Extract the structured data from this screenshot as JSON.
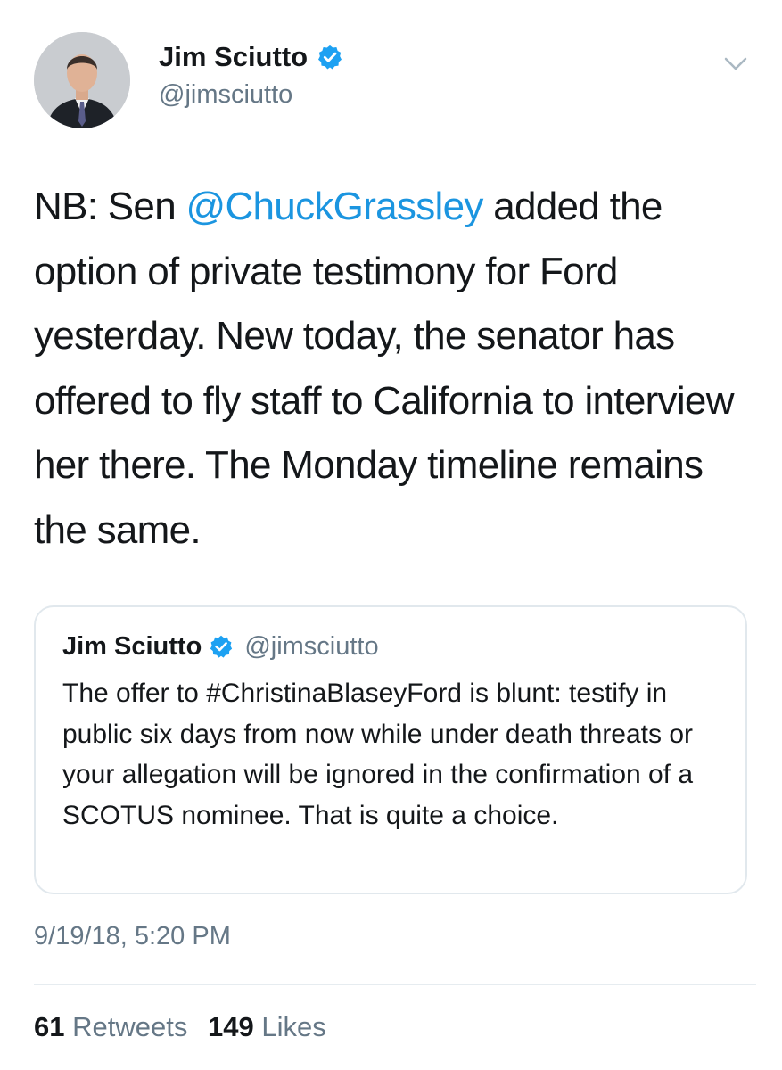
{
  "author": {
    "name": "Jim Sciutto",
    "handle": "@jimsciutto"
  },
  "tweet": {
    "text_before": "NB: Sen ",
    "mention": "@ChuckGrassley",
    "text_after": " added the option of private testimony for Ford yesterday. New today, the senator has offered to fly staff to California to interview her there. The Monday timeline remains the same."
  },
  "quoted_tweet": {
    "name": "Jim Sciutto",
    "handle": "@jimsciutto",
    "text": "The offer to #ChristinaBlaseyFord is blunt: testify in public six days from now while under death threats or your allegation will be ignored in the confirmation of a SCOTUS nominee. That is quite a choice."
  },
  "timestamp": "9/19/18, 5:20 PM",
  "stats": {
    "retweets_count": "61",
    "retweets_label": "Retweets",
    "likes_count": "149",
    "likes_label": "Likes"
  },
  "colors": {
    "accent": "#1b95e0",
    "verified": "#1da1f2",
    "secondary_text": "#657786",
    "border": "#e1e8ed"
  },
  "icons": {
    "verified": "verified-badge-icon",
    "caret": "chevron-down-icon"
  }
}
